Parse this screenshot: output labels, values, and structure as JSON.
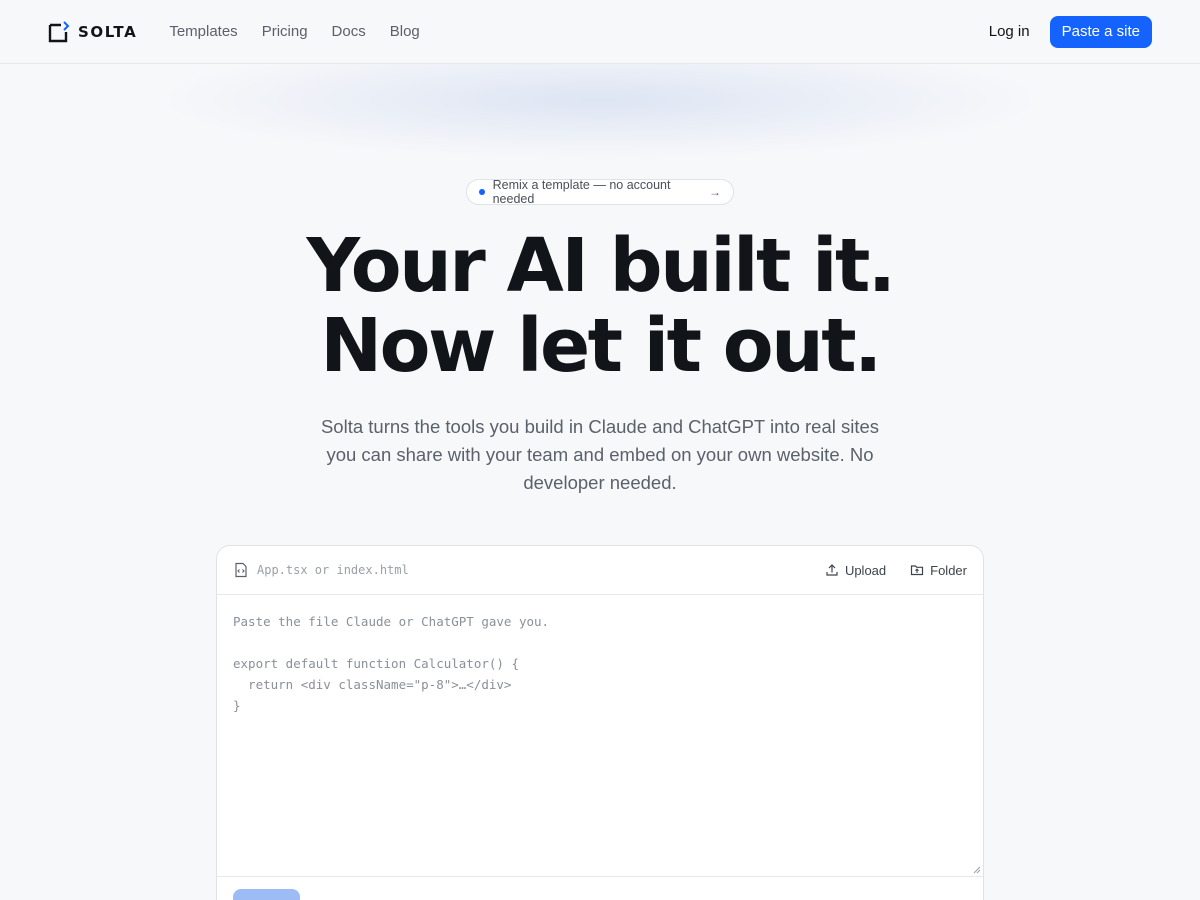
{
  "header": {
    "brand": "SOLTA",
    "nav": [
      {
        "label": "Templates"
      },
      {
        "label": "Pricing"
      },
      {
        "label": "Docs"
      },
      {
        "label": "Blog"
      }
    ],
    "login_label": "Log in",
    "cta_label": "Paste a site"
  },
  "hero": {
    "badge_text": "Remix a template — no account needed",
    "title_line1": "Your AI built it.",
    "title_line2": "Now let it out.",
    "subtitle": "Solta turns the tools you build in Claude and ChatGPT into real sites you can share with your team and embed on your own website. No developer needed."
  },
  "editor": {
    "filename_placeholder": "App.tsx or index.html",
    "upload_label": "Upload",
    "folder_label": "Folder",
    "code_placeholder": "Paste the file Claude or ChatGPT gave you.\n\nexport default function Calculator() {\n  return <div className=\"p-8\">…</div>\n}"
  },
  "colors": {
    "accent": "#1463ff",
    "background": "#f7f8fa",
    "text": "#111418",
    "muted": "#5b616b"
  }
}
